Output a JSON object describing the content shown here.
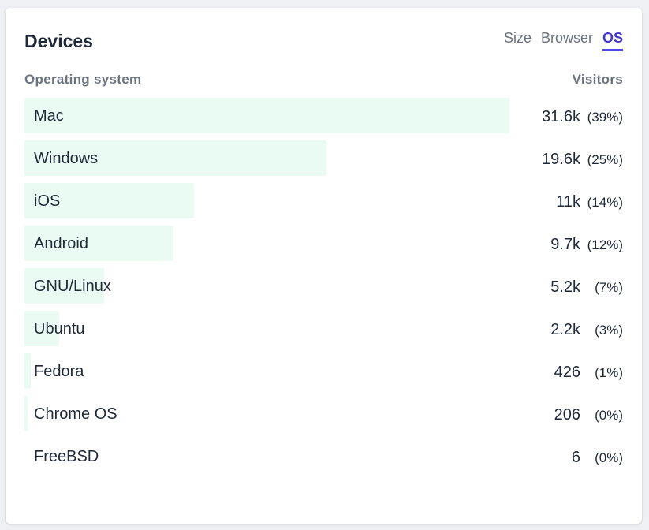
{
  "card": {
    "title": "Devices",
    "tabs": [
      {
        "label": "Size",
        "active": false
      },
      {
        "label": "Browser",
        "active": false
      },
      {
        "label": "OS",
        "active": true
      }
    ]
  },
  "table": {
    "col_left": "Operating system",
    "col_right": "Visitors",
    "rows": [
      {
        "name": "Mac",
        "visitors": "31.6k",
        "pct": "(39%)",
        "fraction": 1.0
      },
      {
        "name": "Windows",
        "visitors": "19.6k",
        "pct": "(25%)",
        "fraction": 0.623
      },
      {
        "name": "iOS",
        "visitors": "11k",
        "pct": "(14%)",
        "fraction": 0.35
      },
      {
        "name": "Android",
        "visitors": "9.7k",
        "pct": "(12%)",
        "fraction": 0.307
      },
      {
        "name": "GNU/Linux",
        "visitors": "5.2k",
        "pct": "(7%)",
        "fraction": 0.165
      },
      {
        "name": "Ubuntu",
        "visitors": "2.2k",
        "pct": "(3%)",
        "fraction": 0.072
      },
      {
        "name": "Fedora",
        "visitors": "426",
        "pct": "(1%)",
        "fraction": 0.013
      },
      {
        "name": "Chrome OS",
        "visitors": "206",
        "pct": "(0%)",
        "fraction": 0.0065
      },
      {
        "name": "FreeBSD",
        "visitors": "6",
        "pct": "(0%)",
        "fraction": 0.0
      }
    ]
  },
  "colors": {
    "bar": "#eafbf3",
    "accent": "#4f46e5",
    "text": "#1f2937",
    "muted": "#6b7280"
  }
}
